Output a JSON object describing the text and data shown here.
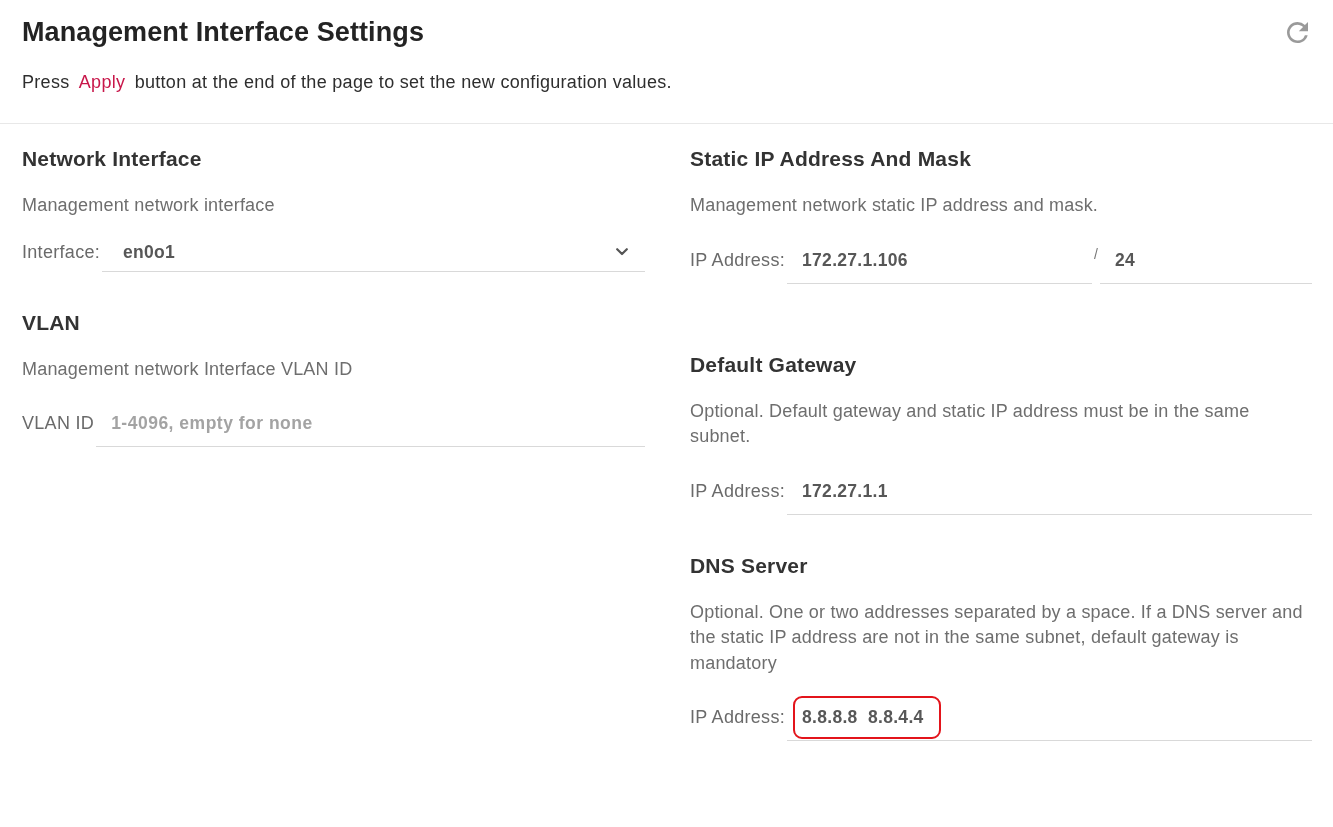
{
  "header": {
    "title": "Management Interface Settings",
    "instruction": {
      "before": "Press",
      "link": "Apply",
      "after": "button at the end of the page to set the new configuration values."
    }
  },
  "columns": [
    {
      "sections": [
        {
          "title": "Network Interface",
          "description": "Management network interface",
          "field": {
            "kind": "select",
            "label": "Interface:",
            "value": "en0o1",
            "highlighted": false
          }
        },
        {
          "title": "VLAN",
          "description": "Management network Interface VLAN ID",
          "field": {
            "kind": "text",
            "label": "VLAN ID",
            "placeholder": "1-4096, empty for none",
            "highlighted": false
          }
        }
      ]
    },
    {
      "sections": [
        {
          "title": "Static IP Address And Mask",
          "description": "Management network static IP address and mask.",
          "field": {
            "kind": "ip_mask",
            "label": "IP Address:",
            "value": "172.27.1.106",
            "separator": "/",
            "mask": "24",
            "highlighted": false
          }
        },
        {
          "title": "Default Gateway",
          "description": "Optional. Default gateway and static IP address must be in the same subnet.",
          "field": {
            "kind": "text",
            "label": "IP Address:",
            "value": "172.27.1.1",
            "highlighted": false
          }
        },
        {
          "title": "DNS Server",
          "description": "Optional. One or two addresses separated by a space. If a DNS server and the static IP address are not in the same subnet, default gateway is mandatory",
          "field": {
            "kind": "text",
            "label": "IP Address:",
            "value": "8.8.8.8  8.8.4.4",
            "highlighted": true
          }
        }
      ]
    }
  ]
}
